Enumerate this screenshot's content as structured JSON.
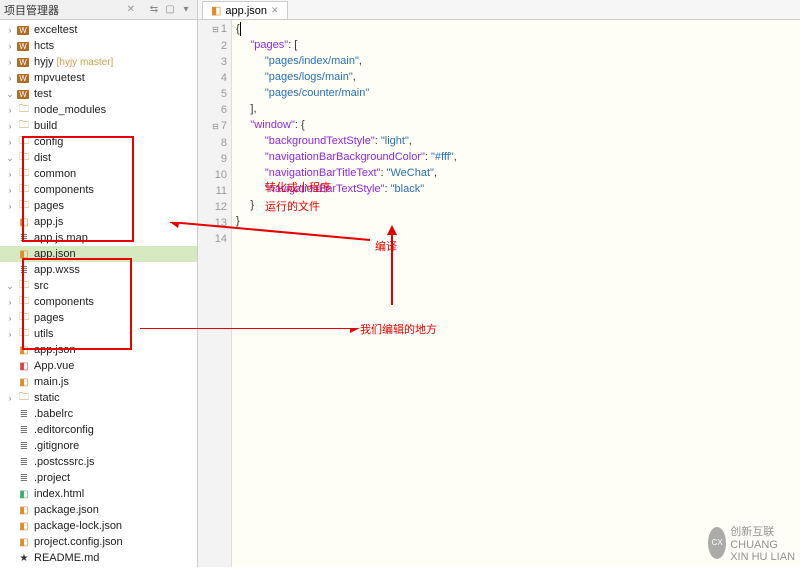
{
  "sidebar": {
    "title": "项目管理器",
    "projects": {
      "exceltest": "exceltest",
      "hcts": "hcts",
      "hyjy": "hyjy",
      "hyjy_branch": "[hyjy master]",
      "mpvuetest": "mpvuetest",
      "test": "test"
    },
    "folders": {
      "node_modules": "node_modules",
      "build": "build",
      "config": "config",
      "dist": "dist",
      "common": "common",
      "components_dist": "components",
      "pages_dist": "pages",
      "src": "src",
      "components_src": "components",
      "pages_src": "pages",
      "utils": "utils",
      "static": "static"
    },
    "files": {
      "app_js": "app.js",
      "app_js_map": "app.js.map",
      "app_json_dist": "app.json",
      "app_wxss": "app.wxss",
      "app_json_src": "app.json",
      "app_vue": "App.vue",
      "main_js": "main.js",
      "babelrc": ".babelrc",
      "editorconfig": ".editorconfig",
      "gitignore": ".gitignore",
      "postcssrc": ".postcssrc.js",
      "project": ".project",
      "index_html": "index.html",
      "package_json": "package.json",
      "package_lock_json": "package-lock.json",
      "project_config_json": "project.config.json",
      "readme_md": "README.md"
    }
  },
  "editor_tab": {
    "filename": "app.json"
  },
  "code": {
    "l1": "{",
    "l2": "  \"pages\": [",
    "l3": "    \"pages/index/main\",",
    "l4": "    \"pages/logs/main\",",
    "l5": "    \"pages/counter/main\"",
    "l6": "  ],",
    "l7": "  \"window\": {",
    "l8": "    \"backgroundTextStyle\": \"light\",",
    "l9": "    \"navigationBarBackgroundColor\": \"#fff\",",
    "l10": "    \"navigationBarTitleText\": \"WeChat\",",
    "l11": "    \"navigationBarTextStyle\": \"black\"",
    "l12": "  }",
    "l13": "}"
  },
  "annotations": {
    "convert_1": "转化成小程序",
    "convert_2": "运行的文件",
    "compile": "编译",
    "edit_place": "我们编辑的地方"
  },
  "gutter_lines": [
    "1",
    "2",
    "3",
    "4",
    "5",
    "6",
    "7",
    "8",
    "9",
    "10",
    "11",
    "12",
    "13",
    "14"
  ],
  "watermark": {
    "brand": "创新互联",
    "sub": "CHUANG XIN HU LIAN"
  }
}
